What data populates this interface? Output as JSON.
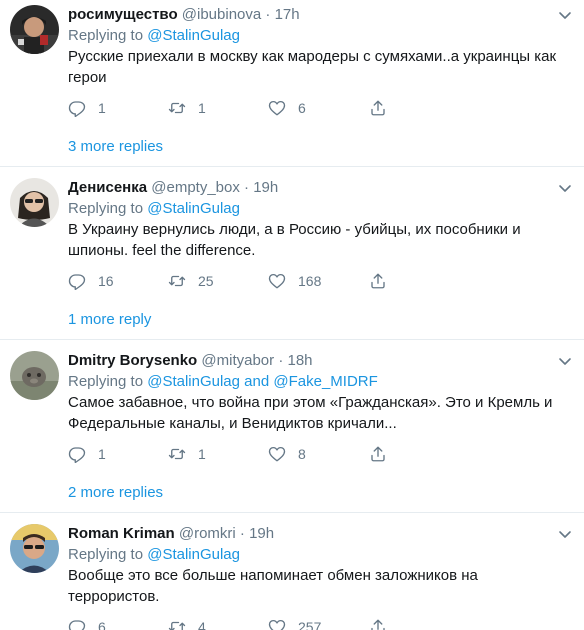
{
  "tweets": [
    {
      "name": "росимущество",
      "handle": "@ibubinova",
      "time": "17h",
      "replying_label": "Replying to",
      "replying_to": "@StalinGulag",
      "text": "Русские приехали в москву как мародеры с сумяхами..а украинцы как герои",
      "replies": "1",
      "retweets": "1",
      "likes": "6",
      "more_replies": "3 more replies",
      "avatar_icon": "avatar-person-icon"
    },
    {
      "name": "Денисенка",
      "handle": "@empty_box",
      "time": "19h",
      "replying_label": "Replying to",
      "replying_to": "@StalinGulag",
      "text": "В Украину вернулись люди, а в Россию - убийцы, их пособники и шпионы. feel the difference.",
      "replies": "16",
      "retweets": "25",
      "likes": "168",
      "more_replies": "1 more reply",
      "avatar_icon": "avatar-person-icon"
    },
    {
      "name": "Dmitry Borysenko",
      "handle": "@mityabor",
      "time": "18h",
      "replying_label": "Replying to",
      "replying_to": "@StalinGulag",
      "replying_and": "and",
      "replying_to_2": "@Fake_MIDRF",
      "text": "Самое забавное, что война при этом «Гражданская». Это и Кремль и Федеральные каналы, и Венидиктов кричали...",
      "replies": "1",
      "retweets": "1",
      "likes": "8",
      "more_replies": "2 more replies",
      "avatar_icon": "avatar-photo-icon"
    },
    {
      "name": "Roman Kriman",
      "handle": "@romkri",
      "time": "19h",
      "replying_label": "Replying to",
      "replying_to": "@StalinGulag",
      "text": "Вообще это все больше напоминает обмен заложников на террористов.",
      "replies": "6",
      "retweets": "4",
      "likes": "257",
      "avatar_icon": "avatar-person-icon"
    }
  ],
  "separator": "·",
  "icons": {
    "reply": "reply-icon",
    "retweet": "retweet-icon",
    "like": "like-icon",
    "share": "share-icon",
    "caret": "chevron-down-icon"
  },
  "colors": {
    "link": "#1b95e0",
    "secondary_text": "#657786",
    "primary_text": "#14171a",
    "divider": "#e6ecf0"
  }
}
